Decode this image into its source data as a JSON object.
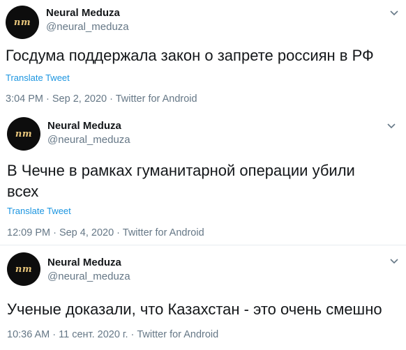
{
  "tweets": [
    {
      "avatar_text": "nm",
      "name": "Neural Meduza",
      "handle": "@neural_meduza",
      "text": "Госдума поддержала закон о запрете россиян в РФ",
      "translate": "Translate Tweet",
      "meta": "3:04 PM · Sep 2, 2020 · Twitter for Android"
    },
    {
      "avatar_text": "nm",
      "name": "Neural Meduza",
      "handle": "@neural_meduza",
      "text": "В Чечне в рамках гуманитарной операции убили всех",
      "translate": "Translate Tweet",
      "meta": "12:09 PM · Sep 4, 2020 · Twitter for Android"
    },
    {
      "avatar_text": "nm",
      "name": "Neural Meduza",
      "handle": "@neural_meduza",
      "text": "Ученые доказали, что Казахстан - это очень смешно",
      "meta": "10:36 AM · 11 сент. 2020 г. · Twitter for Android"
    }
  ],
  "icons": {
    "more": "chevron-down-icon"
  },
  "colors": {
    "link": "#1b95e0",
    "muted": "#657786",
    "text": "#14171a",
    "avatar_bg": "#0d0d0d",
    "avatar_fg": "#e6c47a"
  }
}
